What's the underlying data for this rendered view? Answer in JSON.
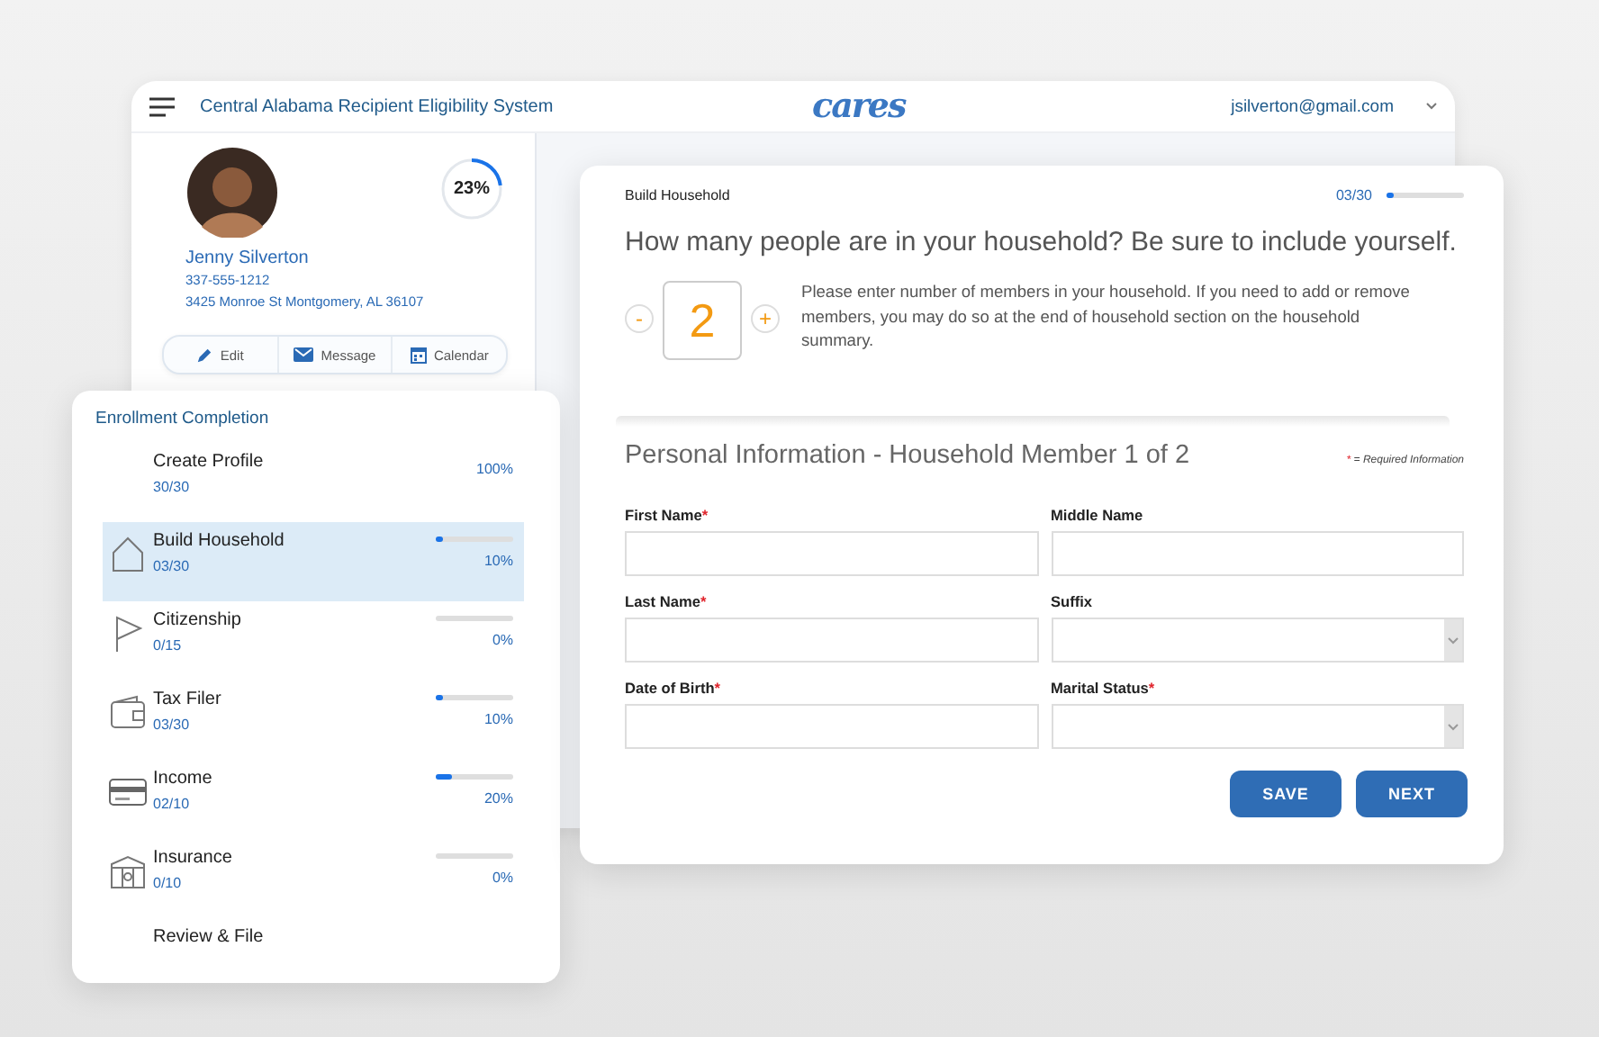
{
  "app_bar": {
    "title": "Central Alabama Recipient Eligibility System",
    "logo": "cares",
    "account": "jsilverton@gmail.com"
  },
  "profile": {
    "name": "Jenny Silverton",
    "phone": "337-555-1212",
    "address": "3425 Monroe St  Montgomery, AL 36107",
    "completion": {
      "text": "23%",
      "level": 0.23
    },
    "actions": [
      {
        "label": "Edit"
      },
      {
        "label": "Message"
      },
      {
        "label": "Calendar"
      }
    ]
  },
  "enrollment": {
    "title": "Enrollment Completion",
    "steps": [
      {
        "kind": "complete",
        "label": "Create Profile",
        "count": "30/30",
        "percent": "100%",
        "selected": false
      },
      {
        "kind": "progress",
        "label": "Build Household",
        "count": "03/30",
        "percent": "10%",
        "level": 0.1,
        "selected": true
      },
      {
        "kind": "progress",
        "label": "Citizenship",
        "count": "0/15",
        "percent": "0%",
        "level": 0,
        "selected": false
      },
      {
        "kind": "progress",
        "label": "Tax Filer",
        "count": "03/30",
        "percent": "10%",
        "level": 0.1,
        "selected": false
      },
      {
        "kind": "progress",
        "label": "Income",
        "count": "02/10",
        "percent": "20%",
        "level": 0.2,
        "selected": false
      },
      {
        "kind": "progress",
        "label": "Insurance",
        "count": "0/10",
        "percent": "0%",
        "level": 0,
        "selected": false
      },
      {
        "kind": "final",
        "label": "Review & File",
        "selected": false
      }
    ]
  },
  "household": {
    "section": "Build Household",
    "count": "03/30",
    "level": 0.1,
    "question": "How many people are in your household? Be sure to include yourself.",
    "stepper": {
      "decrement": "-",
      "value": "2",
      "increment": "+"
    },
    "hint": "Please enter number of members in your household. If you need to add or remove members, you may do so at the end of household section on the household summary."
  },
  "personal": {
    "title": "Personal Information - Household Member 1 of 2",
    "required_mark": "*",
    "required_note": "= Required Information",
    "fields": [
      {
        "kind": "text",
        "label": "First Name",
        "required": true
      },
      {
        "kind": "text",
        "label": "Middle Name",
        "required": false
      },
      {
        "kind": "text",
        "label": "Last Name",
        "required": true
      },
      {
        "kind": "select",
        "label": "Suffix",
        "required": false
      },
      {
        "kind": "text",
        "label": "Date of Birth",
        "required": true
      },
      {
        "kind": "select",
        "label": "Marital Status",
        "required": true
      }
    ],
    "buttons": [
      {
        "label": "SAVE"
      },
      {
        "label": "NEXT"
      }
    ]
  }
}
